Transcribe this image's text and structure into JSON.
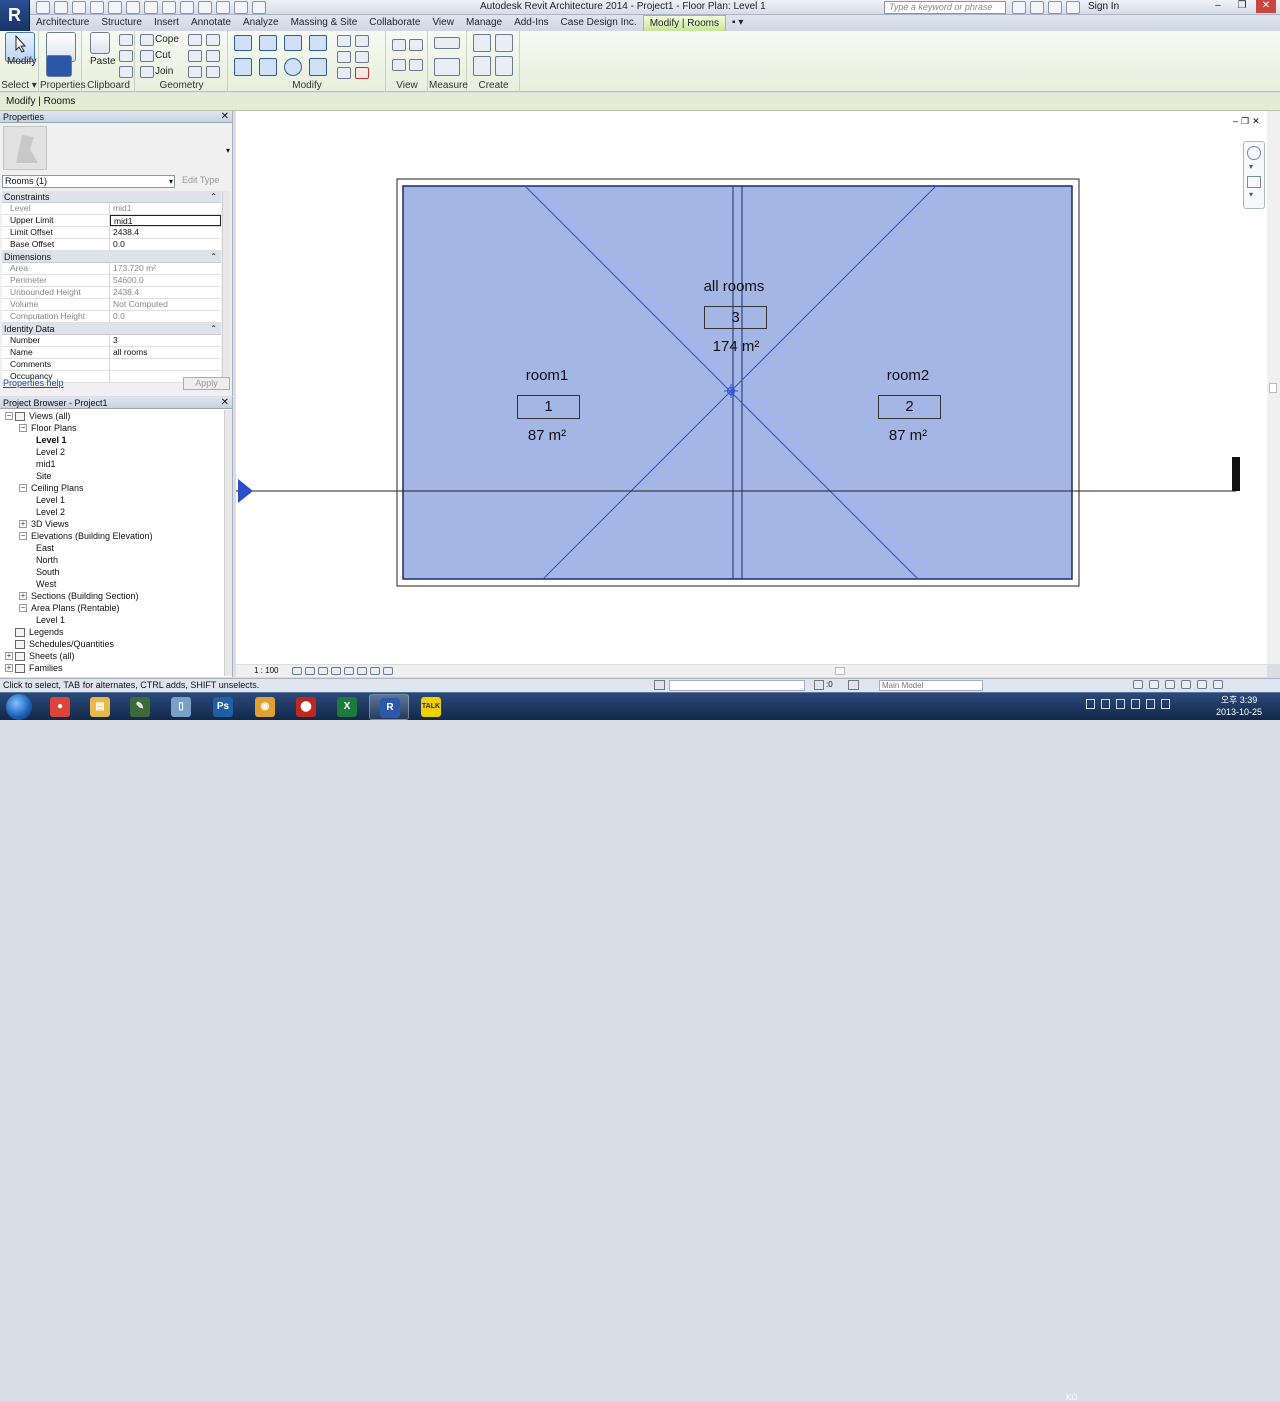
{
  "titlebar": {
    "logo": "R",
    "title": "Autodesk Revit Architecture 2014 -    Project1 - Floor Plan: Level 1",
    "search_placeholder": "Type a keyword or phrase",
    "sign_in": "Sign In",
    "minimize": "–",
    "restore": "❐",
    "close": "✕"
  },
  "ribbon_tabs": [
    "Architecture",
    "Structure",
    "Insert",
    "Annotate",
    "Analyze",
    "Massing & Site",
    "Collaborate",
    "View",
    "Manage",
    "Add-Ins",
    "Case Design Inc.",
    "Modify | Rooms",
    "▪ ▾"
  ],
  "ribbon": {
    "select_label": "Select ▾",
    "modify_label": "Modify",
    "properties_label": "Properties",
    "paste_label": "Paste",
    "clipboard_label": "Clipboard",
    "cope_label": "Cope",
    "cut_label": "Cut",
    "join_label": "Join",
    "geometry_label": "Geometry",
    "modify_panel_label": "Modify",
    "view_label": "View",
    "measure_label": "Measure",
    "create_label": "Create"
  },
  "context_bar": "Modify | Rooms",
  "properties": {
    "title": "Properties",
    "selector": "Rooms (1)",
    "edit_type": "Edit Type",
    "help": "Properties help",
    "apply": "Apply",
    "groups": [
      {
        "name": "Constraints",
        "rows": [
          {
            "k": "Level",
            "v": "mid1",
            "ro": true
          },
          {
            "k": "Upper Limit",
            "v": "mid1",
            "ro": false,
            "edit": true
          },
          {
            "k": "Limit Offset",
            "v": "2438.4",
            "ro": false
          },
          {
            "k": "Base Offset",
            "v": "0.0",
            "ro": false
          }
        ]
      },
      {
        "name": "Dimensions",
        "rows": [
          {
            "k": "Area",
            "v": "173.720 m²",
            "ro": true
          },
          {
            "k": "Perimeter",
            "v": "54600.0",
            "ro": true
          },
          {
            "k": "Unbounded Height",
            "v": "2438.4",
            "ro": true
          },
          {
            "k": "Volume",
            "v": "Not Computed",
            "ro": true
          },
          {
            "k": "Computation Height",
            "v": "0.0",
            "ro": true
          }
        ]
      },
      {
        "name": "Identity Data",
        "rows": [
          {
            "k": "Number",
            "v": "3",
            "ro": false
          },
          {
            "k": "Name",
            "v": "all rooms",
            "ro": false
          },
          {
            "k": "Comments",
            "v": "",
            "ro": false
          },
          {
            "k": "Occupancy",
            "v": "",
            "ro": false
          }
        ]
      }
    ]
  },
  "browser": {
    "title": "Project Browser - Project1",
    "nodes": [
      {
        "label": "Views (all)",
        "depth": 0,
        "exp": "-",
        "icon": true
      },
      {
        "label": "Floor Plans",
        "depth": 1,
        "exp": "-"
      },
      {
        "label": "Level 1",
        "depth": 2,
        "bold": true
      },
      {
        "label": "Level 2",
        "depth": 2
      },
      {
        "label": "mid1",
        "depth": 2
      },
      {
        "label": "Site",
        "depth": 2
      },
      {
        "label": "Ceiling Plans",
        "depth": 1,
        "exp": "-"
      },
      {
        "label": "Level 1",
        "depth": 2
      },
      {
        "label": "Level 2",
        "depth": 2
      },
      {
        "label": "3D Views",
        "depth": 1,
        "exp": "+"
      },
      {
        "label": "Elevations (Building Elevation)",
        "depth": 1,
        "exp": "-"
      },
      {
        "label": "East",
        "depth": 2
      },
      {
        "label": "North",
        "depth": 2
      },
      {
        "label": "South",
        "depth": 2
      },
      {
        "label": "West",
        "depth": 2
      },
      {
        "label": "Sections (Building Section)",
        "depth": 1,
        "exp": "+"
      },
      {
        "label": "Area Plans (Rentable)",
        "depth": 1,
        "exp": "-"
      },
      {
        "label": "Level 1",
        "depth": 2
      },
      {
        "label": "Legends",
        "depth": 0,
        "icon": true
      },
      {
        "label": "Schedules/Quantities",
        "depth": 0,
        "icon": true
      },
      {
        "label": "Sheets (all)",
        "depth": 0,
        "exp": "+",
        "icon": true
      },
      {
        "label": "Families",
        "depth": 0,
        "exp": "+",
        "icon": true
      }
    ]
  },
  "canvas": {
    "rooms": [
      {
        "name": "all rooms",
        "number": "3",
        "area": "174 m²"
      },
      {
        "name": "room1",
        "number": "1",
        "area": "87 m²"
      },
      {
        "name": "room2",
        "number": "2",
        "area": "87 m²"
      }
    ],
    "room_fill": "#a3b6e6",
    "line_color": "#2a4fe0"
  },
  "view_control": {
    "scale": "1 : 100"
  },
  "status": {
    "hint": "Click to select, TAB for alternates, CTRL adds, SHIFT unselects.",
    "zero": ":0",
    "model": "Main Model"
  },
  "taskbar": {
    "apps": [
      {
        "name": "chrome",
        "glyph": "●",
        "color": "#db4437"
      },
      {
        "name": "explorer",
        "glyph": "▤",
        "color": "#e8b84a"
      },
      {
        "name": "notes",
        "glyph": "✎",
        "color": "#3d6a3d"
      },
      {
        "name": "tablet",
        "glyph": "▯",
        "color": "#7aa0c8"
      },
      {
        "name": "photoshop",
        "glyph": "Ps",
        "color": "#1f5fa8"
      },
      {
        "name": "paint",
        "glyph": "◉",
        "color": "#e2a030"
      },
      {
        "name": "acrobat",
        "glyph": "⬤",
        "color": "#c0281c"
      },
      {
        "name": "excel",
        "glyph": "X",
        "color": "#1e7a3c"
      },
      {
        "name": "revit",
        "glyph": "R",
        "color": "#2d57a8",
        "open": true
      },
      {
        "name": "kakaotalk",
        "glyph": "TALK",
        "color": "#f1d000"
      }
    ],
    "lang": "KO",
    "time": "오후 3:39",
    "date": "2013-10-25"
  }
}
